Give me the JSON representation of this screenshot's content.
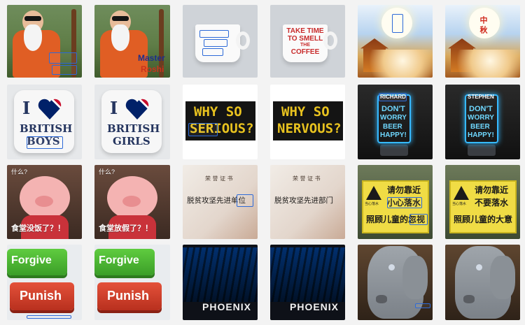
{
  "row1": {
    "a2": {
      "master": "Master",
      "roshi": "Roshi"
    },
    "b2": {
      "line1": "TAKE TIME",
      "line2": "TO SMELL",
      "line3": "THE",
      "line4": "COFFEE"
    },
    "c2": {
      "text": "中 秋"
    }
  },
  "row2": {
    "a1": {
      "i": "I",
      "word1": "BRITISH",
      "word2": "BOYS"
    },
    "a2": {
      "i": "I",
      "word1": "BRITISH",
      "word2": "GIRLS"
    },
    "b1": {
      "line1": "WHY SO",
      "line2": "SERIOUS?"
    },
    "b2": {
      "line1": "WHY SO",
      "line2": "NERVOUS?"
    },
    "c1": {
      "name": "RICHARD",
      "l1": "DON'T",
      "l2": "WORRY",
      "l3": "BEER",
      "l4": "HAPPY!"
    },
    "c2": {
      "name": "STEPHEN",
      "l1": "DON'T",
      "l2": "WORRY",
      "l3": "BEER",
      "l4": "HAPPY!"
    }
  },
  "row3": {
    "a1": {
      "top": "什么?",
      "bottom": "食堂没饭了？！"
    },
    "a2": {
      "top": "什么?",
      "bottom": "食堂放假了？！"
    },
    "b1": {
      "head": "荣 誉 证 书",
      "line": "脱贫攻坚先进单位"
    },
    "b2": {
      "head": "荣 誉 证 书",
      "line": "脱贫攻坚先进部门"
    },
    "c1": {
      "warn": "当心落水",
      "l1": "请勿靠近",
      "l2": "小心落水",
      "l3": "照顾儿童的忽视"
    },
    "c2": {
      "warn": "当心落水",
      "l1": "请勿靠近",
      "l2": "不要落水",
      "l3": "照顾儿童的大意"
    }
  },
  "row4": {
    "a1": {
      "k1": "Forgive",
      "k2": "Punish"
    },
    "a2": {
      "k1": "Forgive",
      "k2": "Punish"
    },
    "b1": {
      "sign": "PHOENIX"
    },
    "b2": {
      "sign": "PHOENIX"
    }
  }
}
